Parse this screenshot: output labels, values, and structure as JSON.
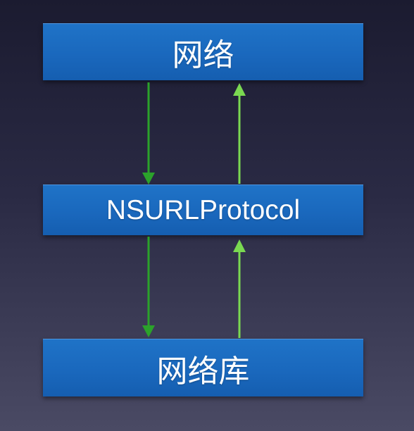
{
  "diagram": {
    "boxes": [
      {
        "id": "top",
        "label": "网络"
      },
      {
        "id": "middle",
        "label": "NSURLProtocol"
      },
      {
        "id": "bottom",
        "label": "网络库"
      }
    ]
  },
  "colors": {
    "box_fill": "#1a68bd",
    "arrow_down": "#2ba22b",
    "arrow_up": "#7ad851",
    "background_top": "#1b1b30",
    "background_bottom": "#4a4a64"
  }
}
